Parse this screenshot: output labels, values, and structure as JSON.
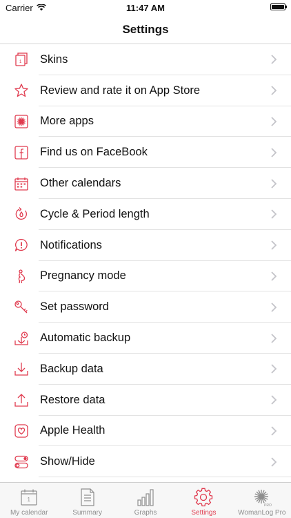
{
  "status_bar": {
    "carrier": "Carrier",
    "time": "11:47 AM"
  },
  "nav": {
    "title": "Settings"
  },
  "colors": {
    "accent": "#e03a4e",
    "inactive": "#8e8e8e"
  },
  "settings": [
    {
      "label": "Skins",
      "icon": "skins-icon"
    },
    {
      "label": "Review and rate it on App Store",
      "icon": "star-icon"
    },
    {
      "label": "More apps",
      "icon": "more-apps-icon"
    },
    {
      "label": "Find us on FaceBook",
      "icon": "facebook-icon"
    },
    {
      "label": "Other calendars",
      "icon": "calendar-icon"
    },
    {
      "label": "Cycle & Period length",
      "icon": "cycle-icon"
    },
    {
      "label": "Notifications",
      "icon": "notification-icon"
    },
    {
      "label": "Pregnancy mode",
      "icon": "pregnancy-icon"
    },
    {
      "label": "Set password",
      "icon": "key-icon"
    },
    {
      "label": "Automatic backup",
      "icon": "auto-backup-icon"
    },
    {
      "label": "Backup data",
      "icon": "backup-icon"
    },
    {
      "label": "Restore data",
      "icon": "restore-icon"
    },
    {
      "label": "Apple Health",
      "icon": "heart-icon"
    },
    {
      "label": "Show/Hide",
      "icon": "toggle-icon"
    }
  ],
  "tabs": [
    {
      "label": "My calendar",
      "icon": "calendar-tab-icon",
      "active": false
    },
    {
      "label": "Summary",
      "icon": "document-icon",
      "active": false
    },
    {
      "label": "Graphs",
      "icon": "bar-chart-icon",
      "active": false
    },
    {
      "label": "Settings",
      "icon": "gear-icon",
      "active": true
    },
    {
      "label": "WomanLog Pro",
      "icon": "pro-logo-icon",
      "active": false
    }
  ]
}
